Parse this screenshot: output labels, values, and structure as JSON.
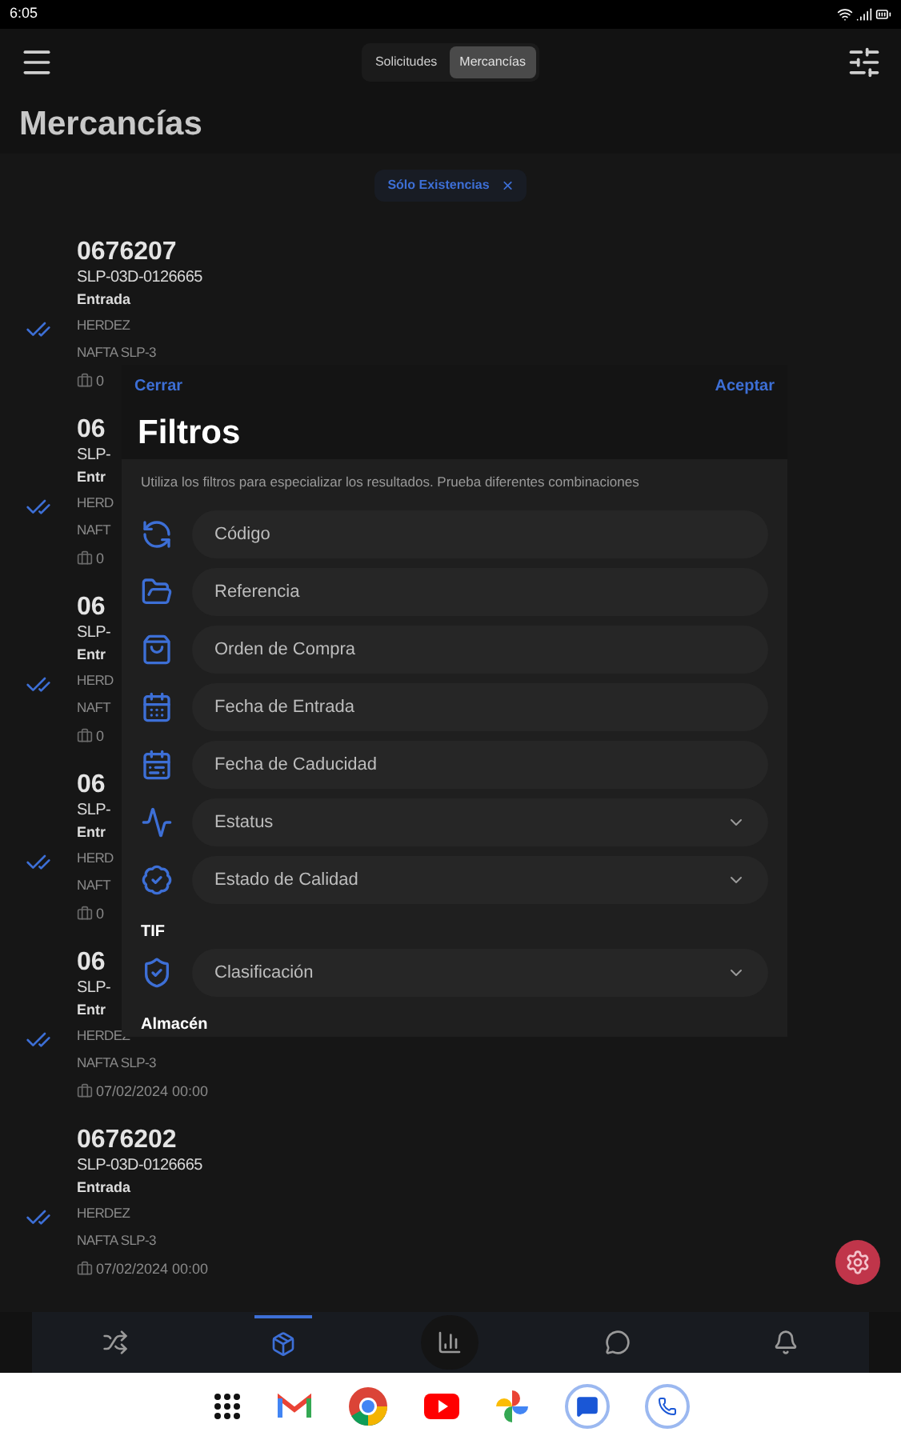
{
  "status_bar": {
    "time": "6:05"
  },
  "segments": [
    {
      "label": "Solicitudes",
      "selected": false
    },
    {
      "label": "Mercancías",
      "selected": true
    }
  ],
  "title": "Mercancías",
  "chip": {
    "label": "Sólo Existencias",
    "close": "×"
  },
  "items": [
    {
      "code": "0676207",
      "reference": "SLP-03D-0126665",
      "type": "Entrada",
      "supplier": "HERDEZ",
      "location": "NAFTA SLP-3",
      "date": "0",
      "checked": true
    },
    {
      "code": "06",
      "reference": "SLP-",
      "type": "Entr",
      "supplier": "HERD",
      "location": "NAFT",
      "date": "0",
      "checked": true
    },
    {
      "code": "06",
      "reference": "SLP-",
      "type": "Entr",
      "supplier": "HERD",
      "location": "NAFT",
      "date": "0",
      "checked": true
    },
    {
      "code": "06",
      "reference": "SLP-",
      "type": "Entr",
      "supplier": "HERD",
      "location": "NAFT",
      "date": "0",
      "checked": true
    },
    {
      "code": "06",
      "reference": "SLP-",
      "type": "Entr",
      "supplier": "HERDEZ",
      "location": "NAFTA SLP-3",
      "date": "07/02/2024 00:00",
      "checked": true
    },
    {
      "code": "0676202",
      "reference": "SLP-03D-0126665",
      "type": "Entrada",
      "supplier": "HERDEZ",
      "location": "NAFTA SLP-3",
      "date": "07/02/2024 00:00",
      "checked": true
    }
  ],
  "filter_sheet": {
    "close": "Cerrar",
    "accept": "Aceptar",
    "title": "Filtros",
    "description": "Utiliza los filtros para especializar los resultados. Prueba diferentes combinaciones",
    "rows": [
      {
        "kind": "text",
        "label": "Código"
      },
      {
        "kind": "text",
        "label": "Referencia"
      },
      {
        "kind": "text",
        "label": "Orden de Compra"
      },
      {
        "kind": "text",
        "label": "Fecha de Entrada"
      },
      {
        "kind": "text",
        "label": "Fecha de Caducidad"
      },
      {
        "kind": "select",
        "label": "Estatus"
      },
      {
        "kind": "select",
        "label": "Estado de Calidad"
      },
      {
        "kind": "section",
        "label": "TIF"
      },
      {
        "kind": "select",
        "label": "Clasificación"
      },
      {
        "kind": "section",
        "label": "Almacén"
      }
    ]
  },
  "bottom_nav": [
    {
      "selected": false
    },
    {
      "selected": true
    },
    {
      "selected": false
    },
    {
      "selected": false
    },
    {
      "selected": false
    }
  ]
}
